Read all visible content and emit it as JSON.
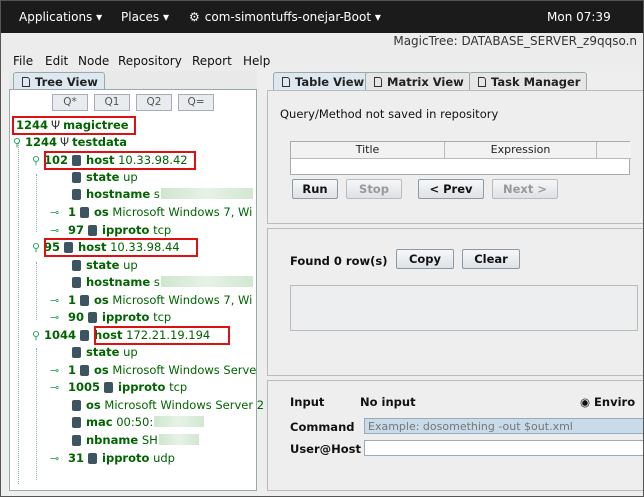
{
  "topbar": {
    "applications": "Applications ▾",
    "places": "Places ▾",
    "app_name": "com-simontuffs-onejar-Boot ▾",
    "clock": "Mon 07:39"
  },
  "window": {
    "title": "MagicTree: DATABASE_SERVER_z9qqso.n"
  },
  "menu": {
    "file": "File",
    "edit": "Edit",
    "node": "Node",
    "repository": "Repository",
    "report": "Report",
    "help": "Help"
  },
  "left": {
    "tab": "Tree View",
    "query_buttons": [
      "Q*",
      "Q1",
      "Q2",
      "Q="
    ],
    "tree": [
      {
        "num": "1244",
        "key": "magictree",
        "val": ""
      },
      {
        "num": "1244",
        "key": "testdata",
        "val": ""
      },
      {
        "num": "102",
        "key": "host",
        "val": "10.33.98.42"
      },
      {
        "num": "",
        "key": "state",
        "val": "up"
      },
      {
        "num": "",
        "key": "hostname",
        "val": "s"
      },
      {
        "num": "1",
        "key": "os",
        "val": "Microsoft Windows 7, Wi"
      },
      {
        "num": "97",
        "key": "ipproto",
        "val": "tcp"
      },
      {
        "num": "95",
        "key": "host",
        "val": "10.33.98.44"
      },
      {
        "num": "",
        "key": "state",
        "val": "up"
      },
      {
        "num": "",
        "key": "hostname",
        "val": "s"
      },
      {
        "num": "1",
        "key": "os",
        "val": "Microsoft Windows 7, Wi"
      },
      {
        "num": "90",
        "key": "ipproto",
        "val": "tcp"
      },
      {
        "num": "1044",
        "key": "host",
        "val": "172.21.19.194"
      },
      {
        "num": "",
        "key": "state",
        "val": "up"
      },
      {
        "num": "1",
        "key": "os",
        "val": "Microsoft Windows Serve"
      },
      {
        "num": "1005",
        "key": "ipproto",
        "val": "tcp"
      },
      {
        "num": "",
        "key": "os",
        "val": "Microsoft Windows Server 2"
      },
      {
        "num": "",
        "key": "mac",
        "val": "00:50:"
      },
      {
        "num": "",
        "key": "nbname",
        "val": "SH"
      },
      {
        "num": "31",
        "key": "ipproto",
        "val": "udp"
      }
    ]
  },
  "right": {
    "tabs": [
      "Table View",
      "Matrix View",
      "Task Manager"
    ],
    "query_status": "Query/Method not saved in repository",
    "columns": [
      "Title",
      "Expression"
    ],
    "run": "Run",
    "stop": "Stop",
    "prev": "< Prev",
    "next": "Next >",
    "found": "Found 0 row(s)",
    "copy": "Copy",
    "clear": "Clear",
    "input_label": "Input",
    "input_value": "No input",
    "environment": "Enviro",
    "command_label": "Command",
    "command_placeholder": "Example: dosomething -out $out.xml",
    "userhost_label": "User@Host"
  }
}
